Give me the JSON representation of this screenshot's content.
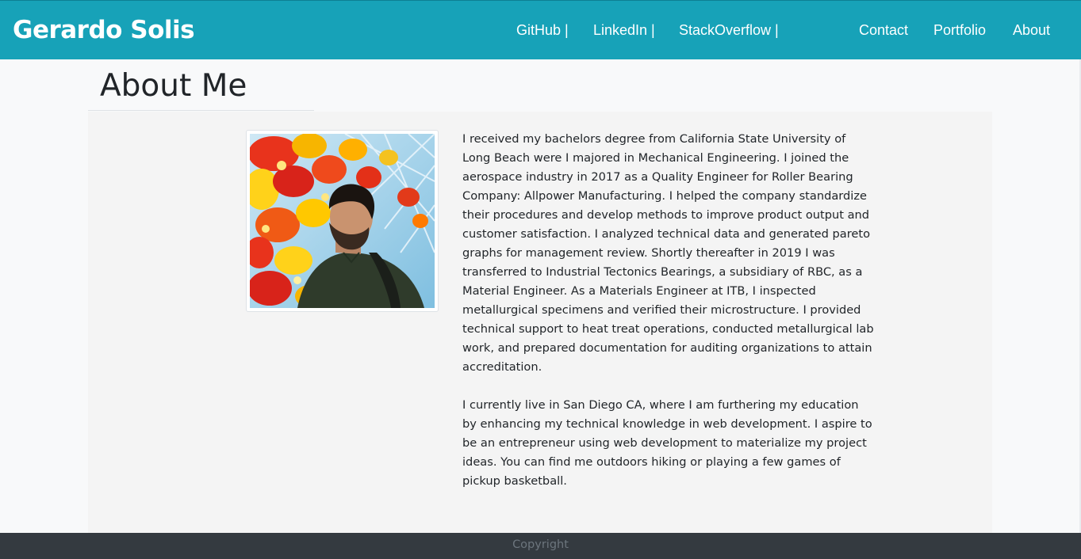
{
  "navbar": {
    "brand": "Gerardo Solis",
    "social_links": [
      {
        "label": "GitHub |"
      },
      {
        "label": "LinkedIn |"
      },
      {
        "label": "StackOverflow |"
      }
    ],
    "page_links": [
      {
        "label": "Contact"
      },
      {
        "label": "Portfolio"
      },
      {
        "label": "About"
      }
    ],
    "colors": {
      "background": "#17a2b8",
      "text": "#ffffff"
    }
  },
  "main": {
    "title": "About Me",
    "photo": {
      "icon": "profile-photo"
    },
    "paragraphs": [
      "I received my bachelors degree from California State University of Long Beach were I majored in Mechanical Engineering. I joined the aerospace industry in 2017 as a Quality Engineer for Roller Bearing Company: Allpower Manufacturing. I helped the company standardize their procedures and develop methods to improve product output and customer satisfaction. I analyzed technical data and generated pareto graphs for management review. Shortly thereafter in 2019 I was transferred to Industrial Tectonics Bearings, a subsidiary of RBC, as a Material Engineer. As a Materials Engineer at ITB, I inspected metallurgical specimens and verified their microstructure. I provided technical support to heat treat operations, conducted metallurgical lab work, and prepared documentation for auditing organizations to attain accreditation.",
      "I currently live in San Diego CA, where I am furthering my education by enhancing my technical knowledge in web development. I aspire to be an entrepreneur using web development to materialize my project ideas. You can find me outdoors hiking or playing a few games of pickup basketball."
    ]
  },
  "footer": {
    "text": "Copyright",
    "colors": {
      "background": "#343a40",
      "text": "#6c757d"
    }
  }
}
